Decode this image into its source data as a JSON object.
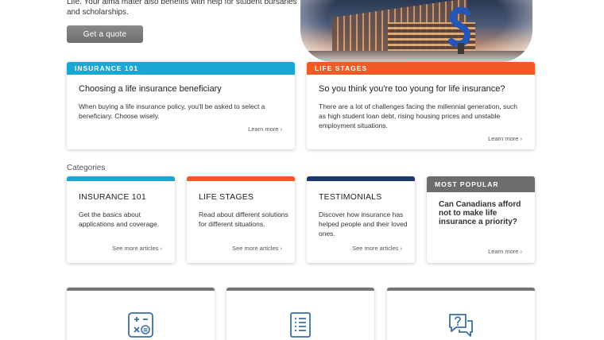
{
  "intro": {
    "text": "Life. Your alma mater also benefits with help for student bursaries and scholarships.",
    "quote_button": "Get a quote"
  },
  "featured": [
    {
      "banner": "INSURANCE 101",
      "banner_color": "#1aa7d4",
      "title": "Choosing a life insurance beneficiary",
      "body": "When buying a life insurance policy, you'll be asked to select a beneficiary. Choose wisely.",
      "link": "Learn more ›"
    },
    {
      "banner": "LIFE STAGES",
      "banner_color": "#f15a24",
      "title": "So you think you're too young for life insurance?",
      "body": "There are a lot of challenges facing the millennial generation, such as high student loan debt, rising housing prices and unstable employment situations.",
      "link": "Learn more ›"
    }
  ],
  "categories": {
    "label": "Categories",
    "items": [
      {
        "title": "INSURANCE 101",
        "color": "#1aa7d4",
        "body": "Get the basics about applications and coverage.",
        "link": "See more articles ›"
      },
      {
        "title": "LIFE STAGES",
        "color": "#f15a24",
        "body": "Read about different solutions for different situations.",
        "link": "See more articles ›"
      },
      {
        "title": "TESTIMONIALS",
        "color": "#1b3a6b",
        "body": "Discover how insurance has helped people and their loved ones.",
        "link": "See more articles ›"
      }
    ],
    "popular": {
      "banner": "MOST POPULAR",
      "title": "Can Canadians afford not to make life insurance a priority?",
      "link": "Learn more ›"
    }
  },
  "tools": [
    {
      "icon": "calculator-icon"
    },
    {
      "icon": "checklist-document-icon"
    },
    {
      "icon": "question-chat-icon"
    }
  ],
  "colors": {
    "accent_blue": "#1aa7d4",
    "accent_orange": "#f15a24",
    "accent_navy": "#1b3a6b",
    "icon_blue": "#3b6fa8"
  }
}
